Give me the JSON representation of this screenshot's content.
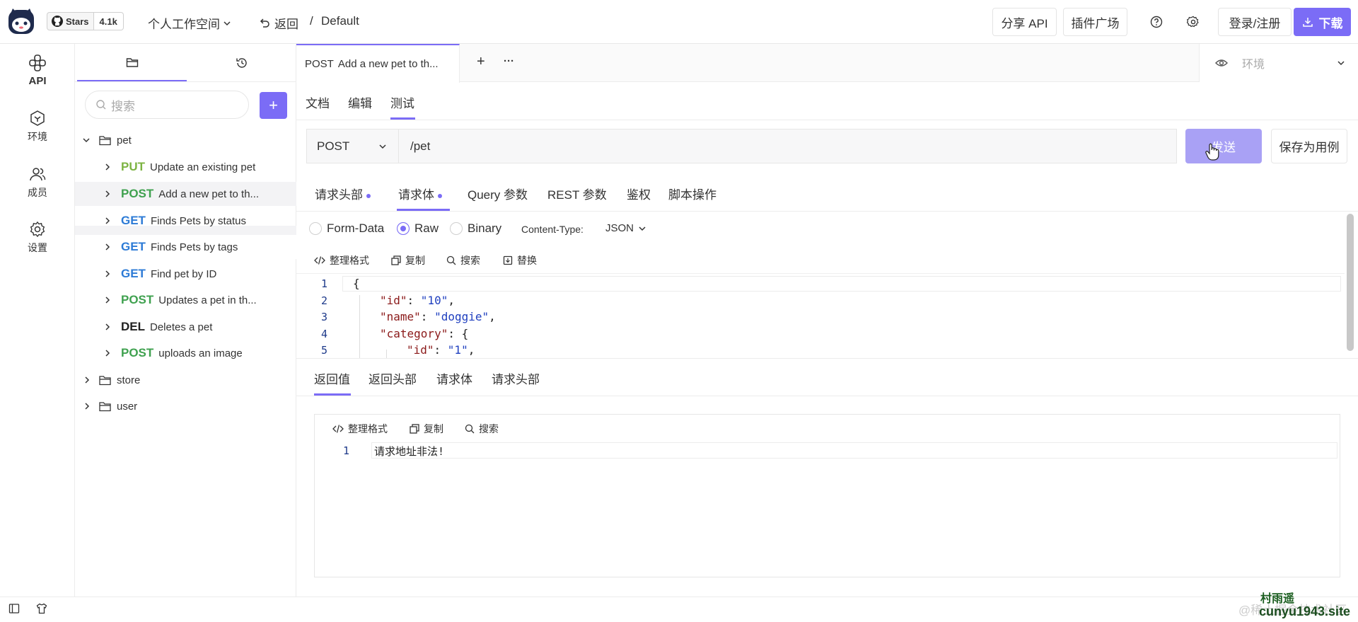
{
  "topbar": {
    "github": {
      "stars_label": "Stars",
      "stars_count": "4.1k"
    },
    "workspace": "个人工作空间",
    "back_label": "返回",
    "separator": "/",
    "project": "Default",
    "share_api": "分享 API",
    "plugins": "插件广场",
    "login": "登录/注册",
    "download": "下载",
    "icons": {
      "help": "help-icon",
      "settings": "gear-icon",
      "download": "download-icon"
    }
  },
  "leftnav": {
    "items": [
      {
        "label": "API",
        "icon": "api-icon"
      },
      {
        "label": "环境",
        "icon": "hexagon-icon"
      },
      {
        "label": "成员",
        "icon": "users-icon"
      },
      {
        "label": "设置",
        "icon": "gear-icon"
      }
    ]
  },
  "sidebar": {
    "search_placeholder": "搜索",
    "add_label": "+",
    "tree": [
      {
        "type": "folder",
        "name": "pet",
        "expanded": true
      },
      {
        "type": "api",
        "method": "PUT",
        "name": "Update an existing pet"
      },
      {
        "type": "api",
        "method": "POST",
        "name": "Add a new pet to th...",
        "selected": true
      },
      {
        "type": "api",
        "method": "GET",
        "name": "Finds Pets by status"
      },
      {
        "type": "api",
        "method": "GET",
        "name": "Finds Pets by tags"
      },
      {
        "type": "api",
        "method": "GET",
        "name": "Find pet by ID"
      },
      {
        "type": "api",
        "method": "POST",
        "name": "Updates a pet in th..."
      },
      {
        "type": "api",
        "method": "DEL",
        "name": "Deletes a pet"
      },
      {
        "type": "api",
        "method": "POST",
        "name": "uploads an image"
      },
      {
        "type": "folder",
        "name": "store",
        "expanded": false
      },
      {
        "type": "folder",
        "name": "user",
        "expanded": false
      }
    ]
  },
  "main": {
    "open_tab": {
      "method": "POST",
      "title": "Add a new pet to th..."
    },
    "add_tab": "+",
    "more": "···",
    "env_label": "环境",
    "view_tabs": [
      "文档",
      "编辑",
      "测试"
    ],
    "request": {
      "method": "POST",
      "url": "/pet",
      "send": "发送",
      "save_case": "保存为用例"
    },
    "req_tabs": [
      "请求头部",
      "请求体",
      "Query 参数",
      "REST 参数",
      "鉴权",
      "脚本操作"
    ],
    "body_types": [
      "Form-Data",
      "Raw",
      "Binary"
    ],
    "content_type_label": "Content-Type:",
    "content_type_value": "JSON",
    "editor_tools": [
      "整理格式",
      "复制",
      "搜索",
      "替换"
    ],
    "code_lines": [
      {
        "n": "1",
        "parts": [
          [
            "punc",
            "{"
          ]
        ]
      },
      {
        "n": "2",
        "parts": [
          [
            "key",
            "\"id\""
          ],
          [
            "punc",
            ": "
          ],
          [
            "str",
            "\"10\""
          ],
          [
            "punc",
            ","
          ]
        ]
      },
      {
        "n": "3",
        "parts": [
          [
            "key",
            "\"name\""
          ],
          [
            "punc",
            ": "
          ],
          [
            "str",
            "\"doggie\""
          ],
          [
            "punc",
            ","
          ]
        ]
      },
      {
        "n": "4",
        "parts": [
          [
            "key",
            "\"category\""
          ],
          [
            "punc",
            ": {"
          ]
        ]
      },
      {
        "n": "5",
        "parts": [
          [
            "key",
            "\"id\""
          ],
          [
            "punc",
            ": "
          ],
          [
            "str",
            "\"1\""
          ],
          [
            "punc",
            ","
          ]
        ]
      }
    ],
    "resp_tabs": [
      "返回值",
      "返回头部",
      "请求体",
      "请求头部"
    ],
    "resp_tools": [
      "整理格式",
      "复制",
      "搜索"
    ],
    "resp_line_no": "1",
    "resp_text": "请求地址非法!"
  },
  "watermark": {
    "line1": "村雨遥",
    "line2": "cunyu1943.site",
    "faint": "@稀土掘金技术社区"
  },
  "colors": {
    "accent": "#7b6cf6",
    "get": "#2d7bd6",
    "post": "#3fa14f",
    "put": "#7cb342"
  }
}
